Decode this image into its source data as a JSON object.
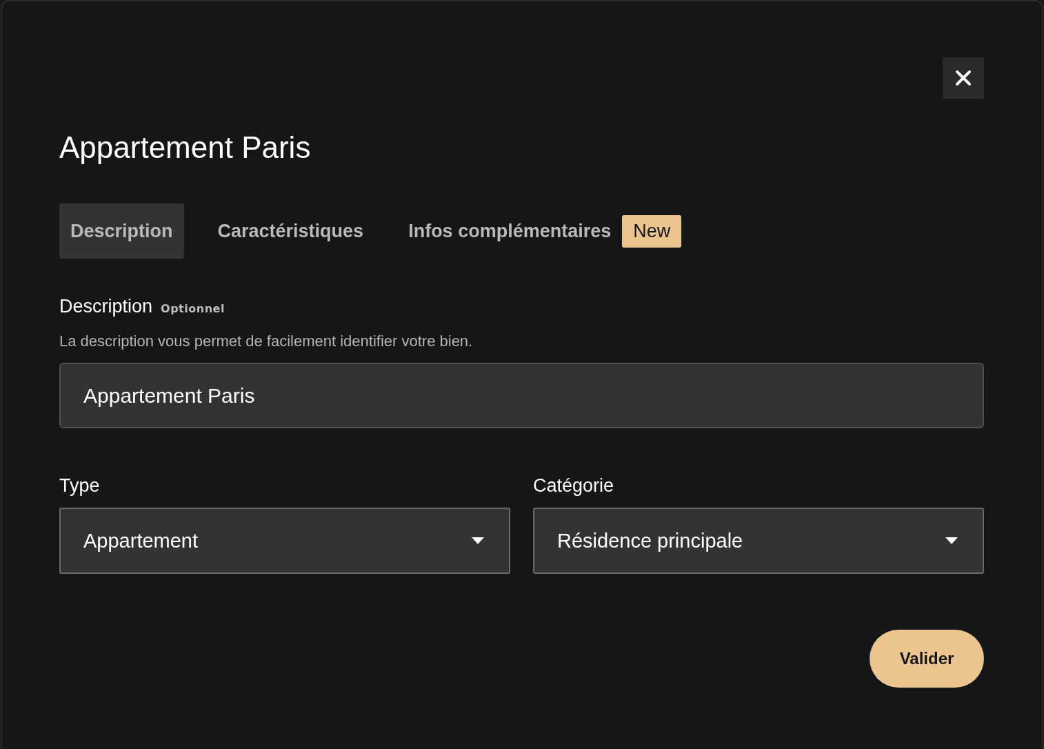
{
  "dialog": {
    "title": "Appartement Paris"
  },
  "tabs": [
    {
      "label": "Description",
      "selected": true
    },
    {
      "label": "Caractéristiques",
      "selected": false
    },
    {
      "label": "Infos complémentaires",
      "selected": false,
      "badge": "New"
    }
  ],
  "description": {
    "label": "Description",
    "optional": "Optionnel",
    "help": "La description vous permet de facilement identifier votre bien.",
    "value": "Appartement Paris"
  },
  "selects": [
    {
      "label": "Type",
      "value": "Appartement"
    },
    {
      "label": "Catégorie",
      "value": "Résidence principale"
    }
  ],
  "submit": "Valider"
}
